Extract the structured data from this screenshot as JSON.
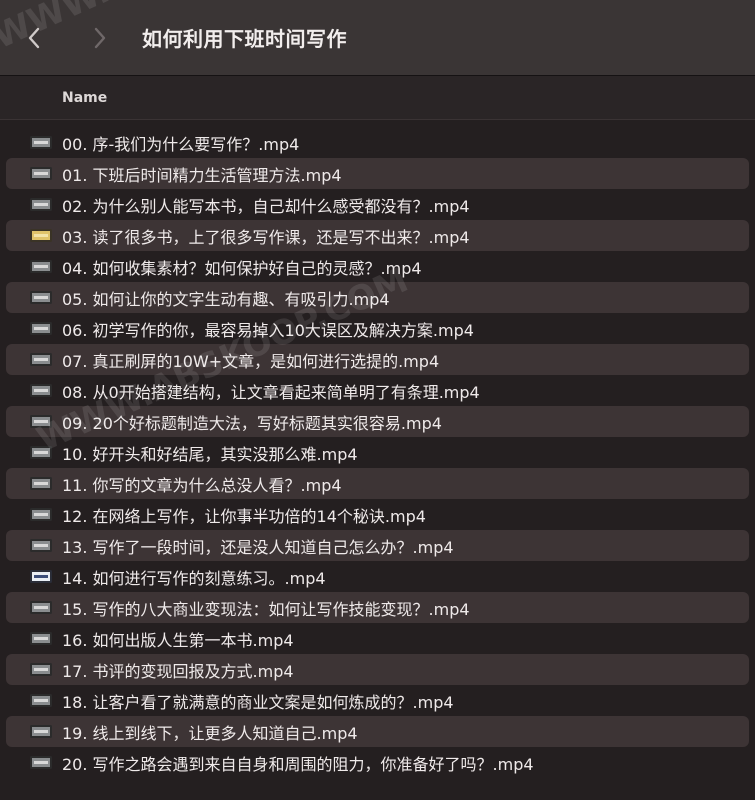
{
  "window": {
    "title": "如何利用下班时间写作"
  },
  "nav": {
    "back_icon": "chevron-left-icon",
    "forward_icon": "chevron-right-icon"
  },
  "columns": {
    "name": "Name"
  },
  "files": [
    {
      "name": "00. 序-我们为什么要写作？.mp4",
      "thumb": "dark"
    },
    {
      "name": "01. 下班后时间精力生活管理方法.mp4",
      "thumb": "dark"
    },
    {
      "name": "02. 为什么别人能写本书，自己却什么感受都没有？.mp4",
      "thumb": "dark"
    },
    {
      "name": "03. 读了很多书，上了很多写作课，还是写不出来？.mp4",
      "thumb": "yellow"
    },
    {
      "name": "04. 如何收集素材？如何保护好自己的灵感？.mp4",
      "thumb": "dark"
    },
    {
      "name": "05. 如何让你的文字生动有趣、有吸引力.mp4",
      "thumb": "dark"
    },
    {
      "name": "06. 初学写作的你，最容易掉入10大误区及解决方案.mp4",
      "thumb": "dark"
    },
    {
      "name": "07. 真正刷屏的10W+文章，是如何进行选提的.mp4",
      "thumb": "dark"
    },
    {
      "name": "08. 从0开始搭建结构，让文章看起来简单明了有条理.mp4",
      "thumb": "dark"
    },
    {
      "name": "09. 20个好标题制造大法，写好标题其实很容易.mp4",
      "thumb": "dark"
    },
    {
      "name": "10. 好开头和好结尾，其实没那么难.mp4",
      "thumb": "dark"
    },
    {
      "name": "11. 你写的文章为什么总没人看？.mp4",
      "thumb": "dark"
    },
    {
      "name": "12. 在网络上写作，让你事半功倍的14个秘诀.mp4",
      "thumb": "dark"
    },
    {
      "name": "13. 写作了一段时间，还是没人知道自己怎么办？.mp4",
      "thumb": "dark"
    },
    {
      "name": "14. 如何进行写作的刻意练习。.mp4",
      "thumb": "blue"
    },
    {
      "name": "15. 写作的八大商业变现法：如何让写作技能变现？.mp4",
      "thumb": "dark"
    },
    {
      "name": "16. 如何出版人生第一本书.mp4",
      "thumb": "dark"
    },
    {
      "name": "17. 书评的变现回报及方式.mp4",
      "thumb": "dark"
    },
    {
      "name": "18. 让客户看了就满意的商业文案是如何炼成的？.mp4",
      "thumb": "dark"
    },
    {
      "name": "19. 线上到线下，让更多人知道自己.mp4",
      "thumb": "dark"
    },
    {
      "name": "20. 写作之路会遇到来自自身和周围的阻力，你准备好了吗？.mp4",
      "thumb": "dark"
    }
  ],
  "colors": {
    "toolbar": "#3a3535",
    "background": "#241f20",
    "alt_row": "#3d3435",
    "text": "#efeaea"
  }
}
